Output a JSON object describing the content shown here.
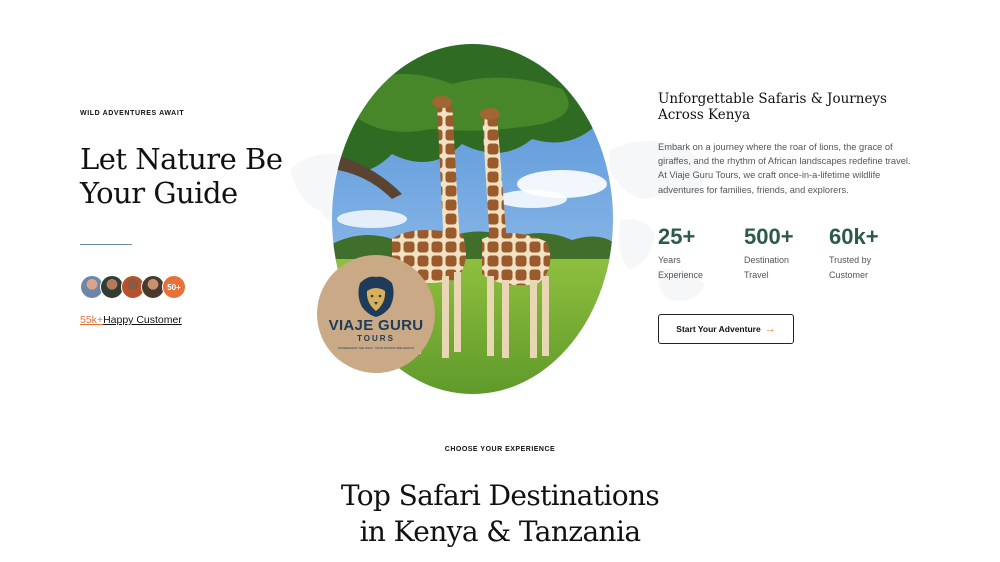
{
  "hero": {
    "eyebrow": "WILD ADVENTURES AWAIT",
    "title": "Let Nature Be Your Guide",
    "avatars_badge": "50+",
    "happy_count": "55k+",
    "happy_label": "Happy Customer"
  },
  "logo": {
    "brand": "VIAJE GURU",
    "sub": "TOURS",
    "tagline": "EXPERIENCE THE WILD, YOUR ADVENTURE AWAITS"
  },
  "intro": {
    "title": "Unforgettable Safaris & Journeys Across Kenya",
    "paragraph": "Embark on a journey where the roar of lions, the grace of giraffes, and the rhythm of African landscapes redefine travel. At Viaje Guru Tours, we craft once-in-a-lifetime wildlife adventures for families, friends, and explorers.",
    "stats": [
      {
        "value": "25+",
        "label": "Years Experience"
      },
      {
        "value": "500+",
        "label": "Destination Travel"
      },
      {
        "value": "60k+",
        "label": "Trusted by Customer"
      }
    ],
    "cta_label": "Start Your Adventure",
    "cta_icon": "arrow-right-icon"
  },
  "destinations": {
    "eyebrow": "CHOOSE YOUR EXPERIENCE",
    "title": "Top Safari Destinations in Kenya & Tanzania"
  },
  "colors": {
    "accent": "#e8703a",
    "stat_green": "#2e5a48",
    "logo_bg": "#c9a986",
    "logo_navy": "#1f3b5a"
  }
}
